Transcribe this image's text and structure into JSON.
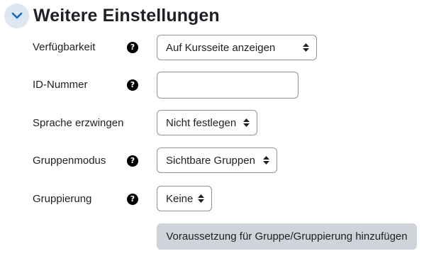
{
  "section": {
    "title": "Weitere Einstellungen",
    "collapse_icon": "chevron-down-icon"
  },
  "fields": [
    {
      "label": "Verfügbarkeit",
      "help_icon": "question-circle-icon",
      "type": "select",
      "value": "Auf Kursseite anzeigen"
    },
    {
      "label": "ID-Nummer",
      "help_icon": "question-circle-icon",
      "type": "text",
      "value": ""
    },
    {
      "label": "Sprache erzwingen",
      "type": "select",
      "value": "Nicht festlegen"
    },
    {
      "label": "Gruppenmodus",
      "help_icon": "question-circle-icon",
      "type": "select",
      "value": "Sichtbare Gruppen"
    },
    {
      "label": "Gruppierung",
      "help_icon": "question-circle-icon",
      "type": "select",
      "value": "Keine"
    }
  ],
  "add_restriction_button": {
    "label": "Voraussetzung für Gruppe/Gruppierung hinzufügen"
  },
  "colors": {
    "collapse_bg": "#dde6f1",
    "collapse_chevron": "#0f6cbf",
    "button_bg": "#ced4da",
    "border": "#8f959e",
    "text": "#1d2125"
  }
}
